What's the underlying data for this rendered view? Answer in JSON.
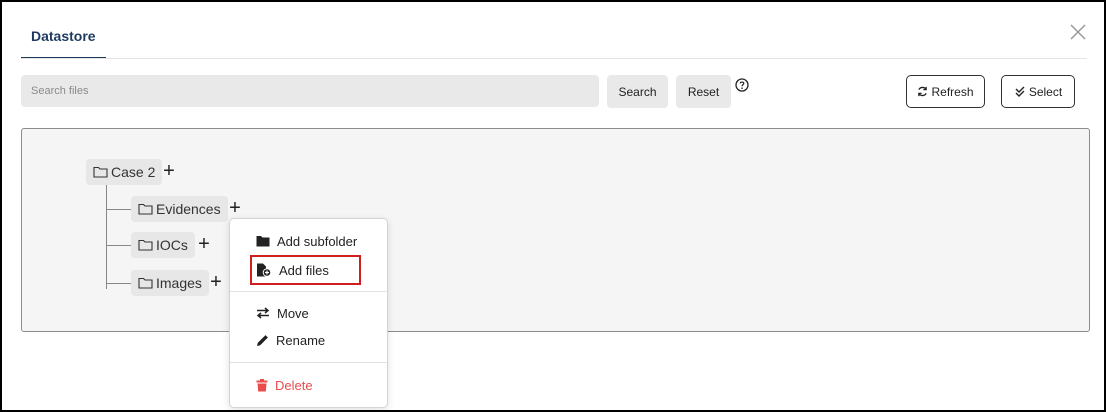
{
  "dialog": {
    "tab_label": "Datastore"
  },
  "search": {
    "placeholder": "Search files",
    "search_label": "Search",
    "reset_label": "Reset"
  },
  "toolbar": {
    "refresh_label": "Refresh",
    "select_label": "Select"
  },
  "tree": {
    "root": {
      "label": "Case 2"
    },
    "children": [
      {
        "label": "Evidences"
      },
      {
        "label": "IOCs"
      },
      {
        "label": "Images"
      }
    ]
  },
  "context_menu": {
    "items": [
      {
        "label": "Add subfolder",
        "icon": "folder-icon"
      },
      {
        "label": "Add files",
        "icon": "file-add-icon"
      },
      {
        "label": "Move",
        "icon": "swap-arrows-icon"
      },
      {
        "label": "Rename",
        "icon": "pencil-icon"
      },
      {
        "label": "Delete",
        "icon": "trash-icon"
      }
    ]
  },
  "colors": {
    "tab_accent": "#1f3a5f",
    "highlight_border": "#d01f1f",
    "delete_text": "#ea4c4c",
    "tree_bg": "#f5f5f5"
  }
}
